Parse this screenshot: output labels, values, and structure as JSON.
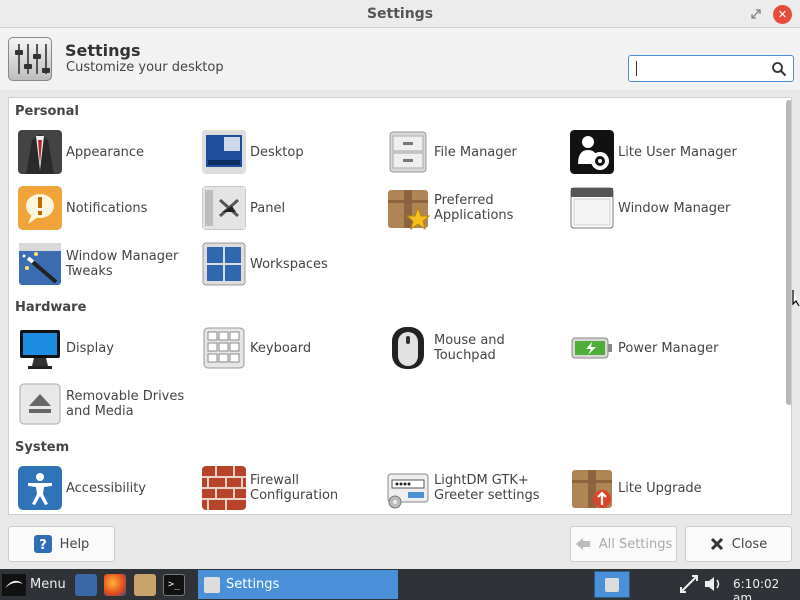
{
  "window": {
    "title": "Settings"
  },
  "header": {
    "title": "Settings",
    "subtitle": "Customize your desktop"
  },
  "search": {
    "value": "",
    "placeholder": ""
  },
  "sections": {
    "personal": {
      "label": "Personal",
      "items": [
        "Appearance",
        "Desktop",
        "File Manager",
        "Lite User Manager",
        "Notifications",
        "Panel",
        "Preferred Applications",
        "Window Manager",
        "Window Manager Tweaks",
        "Workspaces"
      ]
    },
    "hardware": {
      "label": "Hardware",
      "items": [
        "Display",
        "Keyboard",
        "Mouse and Touchpad",
        "Power Manager",
        "Removable Drives and Media"
      ]
    },
    "system": {
      "label": "System",
      "items": [
        "Accessibility",
        "Firewall Configuration",
        "LightDM GTK+ Greeter settings",
        "Lite Upgrade"
      ]
    }
  },
  "buttons": {
    "help": "Help",
    "all_settings": "All Settings",
    "close": "Close"
  },
  "taskbar": {
    "menu": "Menu",
    "task_title": "Settings",
    "clock": "6:10:02 am"
  },
  "colors": {
    "accent": "#4a90d9",
    "close_button": "#e74c3c",
    "taskbar_bg": "#2f3338"
  }
}
